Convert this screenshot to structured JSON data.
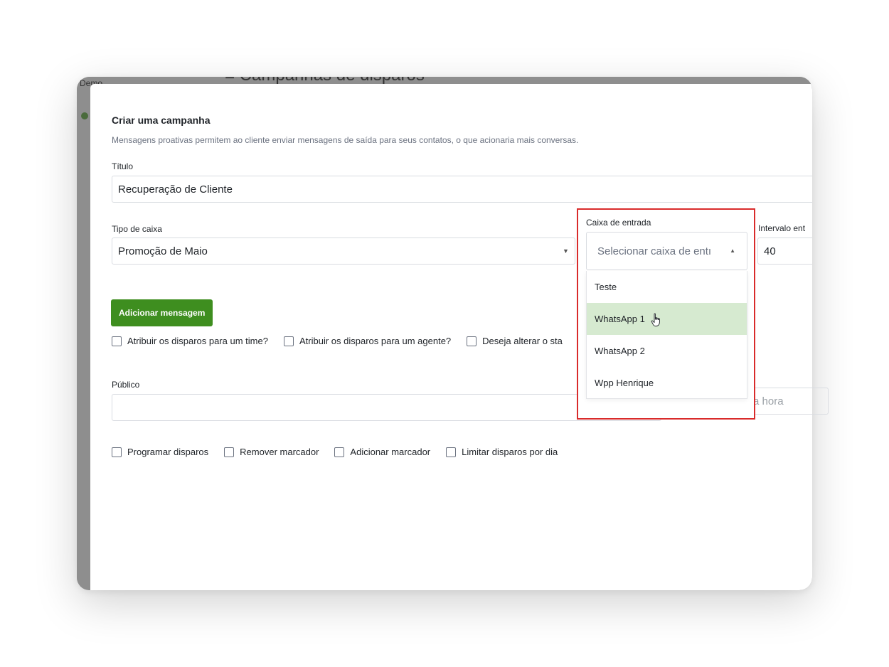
{
  "background": {
    "app_label": "Demo",
    "page_title": "Campanhas de disparos"
  },
  "modal": {
    "title": "Criar uma campanha",
    "description": "Mensagens proativas permitem ao cliente enviar mensagens de saída para seus contatos, o que acionaria mais conversas."
  },
  "form": {
    "titulo_label": "Título",
    "titulo_value": "Recuperação de Cliente",
    "tipo_caixa_label": "Tipo de caixa",
    "tipo_caixa_value": "Promoção de Maio",
    "intervalo_label": "Intervalo ent",
    "intervalo_value": "40",
    "add_message_button": "Adicionar mensagem",
    "options_row1": [
      "Atribuir os disparos para um time?",
      "Atribuir os disparos para um agente?",
      "Deseja alterar o sta"
    ],
    "publico_label": "Público",
    "publico_value": "",
    "hora_placeholder": "Por favor insira a hora",
    "options_row2": [
      "Programar disparos",
      "Remover marcador",
      "Adicionar marcador",
      "Limitar disparos por dia"
    ]
  },
  "inbox_dropdown": {
    "label": "Caixa de entrada",
    "placeholder": "Selecionar caixa de entı",
    "options": [
      "Teste",
      "WhatsApp 1",
      "WhatsApp 2",
      "Wpp Henrique"
    ],
    "highlighted": "WhatsApp 1",
    "highlight_color": "#d6ead0",
    "outline_color": "#d92b2b"
  },
  "colors": {
    "primary_button": "#3e8e1f"
  }
}
